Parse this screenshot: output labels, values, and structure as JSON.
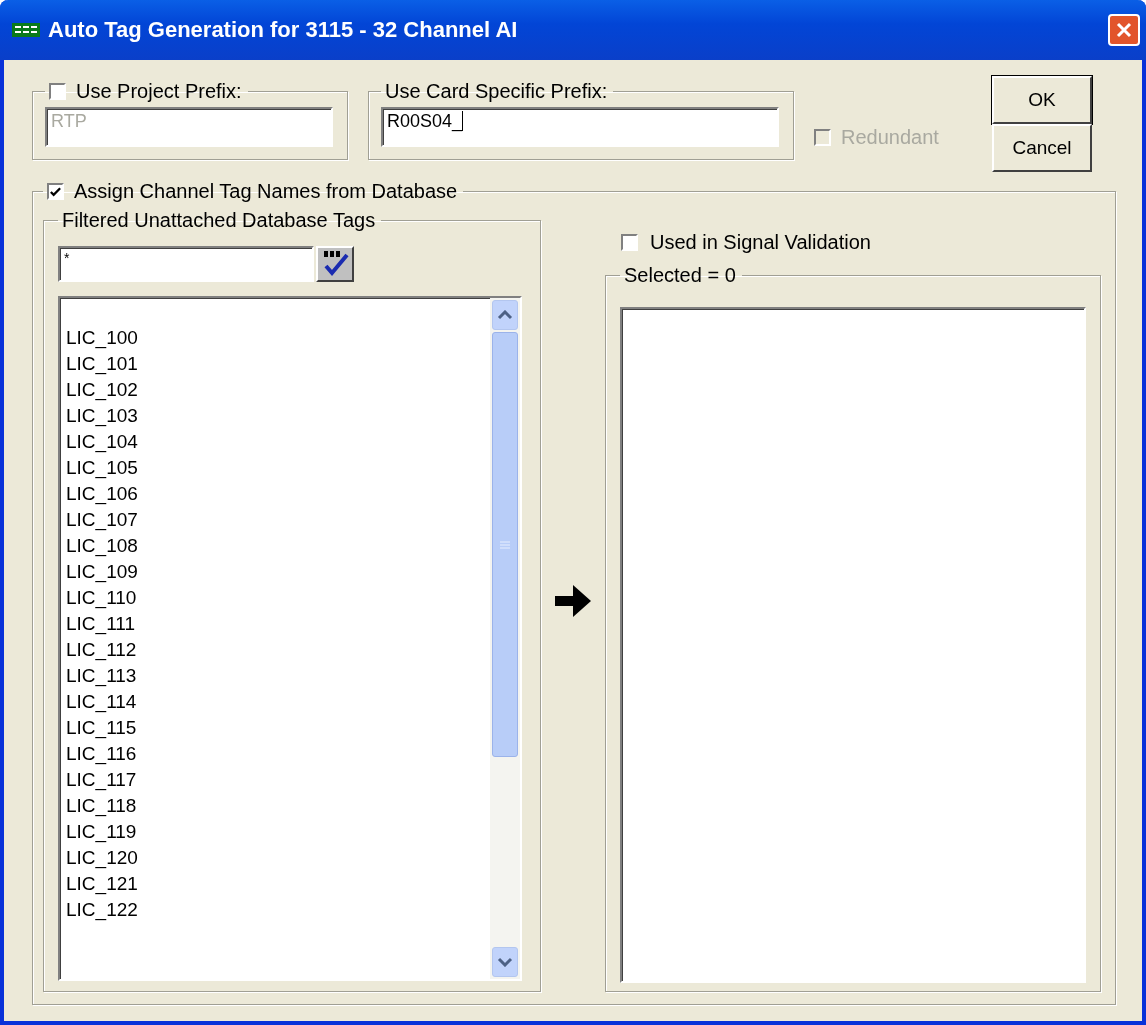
{
  "window": {
    "title": "Auto Tag Generation for 3115 - 32 Channel AI"
  },
  "project_prefix": {
    "label": "Use Project Prefix:",
    "checked": false,
    "value": "RTP",
    "disabled": true
  },
  "card_prefix": {
    "label": "Use Card Specific Prefix:",
    "value": "R00S04_"
  },
  "redundant": {
    "label": "Redundant",
    "checked": false,
    "disabled": true
  },
  "buttons": [
    "OK",
    "Cancel"
  ],
  "assign": {
    "label": "Assign Channel Tag Names from Database",
    "checked": true
  },
  "filtered_tags": {
    "label": "Filtered Unattached Database Tags",
    "filter": "*",
    "items": [
      "LIC_100",
      "LIC_101",
      "LIC_102",
      "LIC_103",
      "LIC_104",
      "LIC_105",
      "LIC_106",
      "LIC_107",
      "LIC_108",
      "LIC_109",
      "LIC_110",
      "LIC_111",
      "LIC_112",
      "LIC_113",
      "LIC_114",
      "LIC_115",
      "LIC_116",
      "LIC_117",
      "LIC_118",
      "LIC_119",
      "LIC_120",
      "LIC_121",
      "LIC_122"
    ]
  },
  "signal_validation": {
    "label": "Used in Signal Validation",
    "checked": false
  },
  "selected_list": {
    "label": "Selected = 0"
  }
}
